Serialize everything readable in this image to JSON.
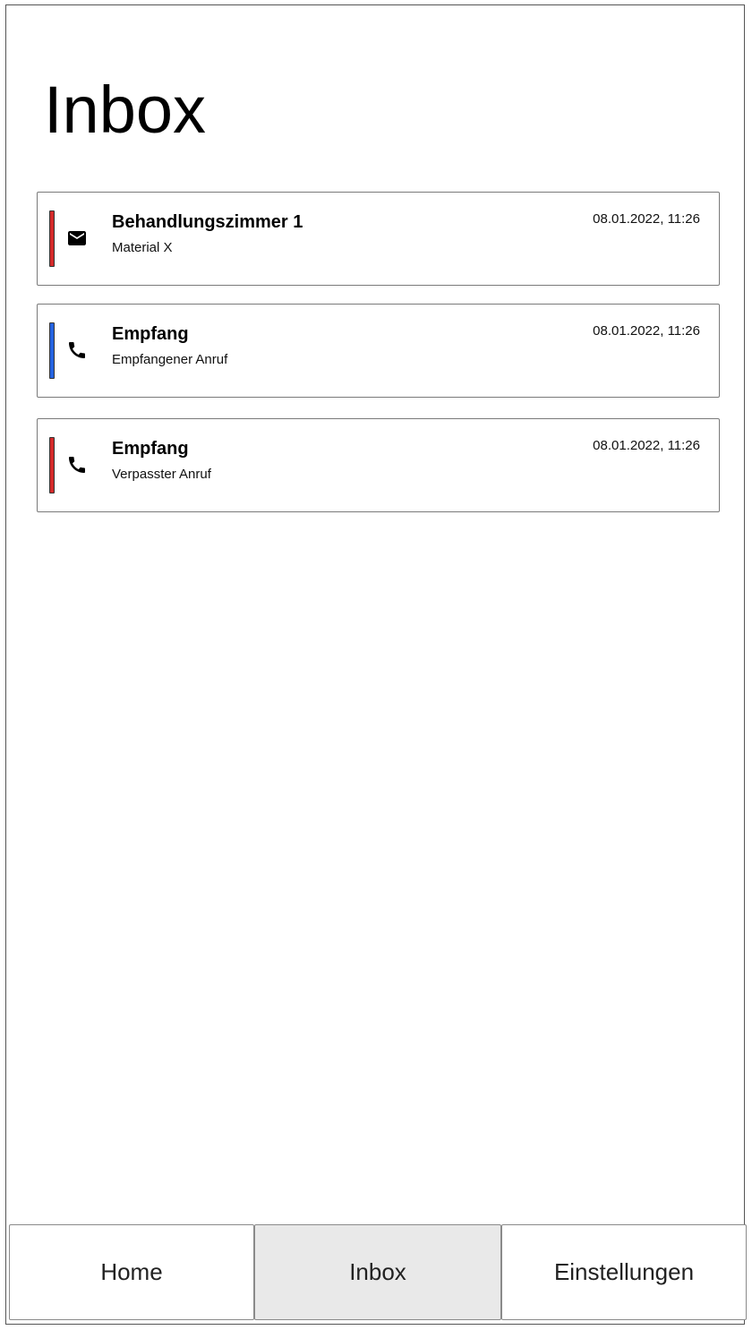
{
  "page": {
    "title": "Inbox"
  },
  "messages": [
    {
      "title": "Behandlungszimmer 1",
      "subtitle": "Material X",
      "timestamp": "08.01.2022, 11:26",
      "icon": "mail-icon",
      "accent": "#d42a2a"
    },
    {
      "title": "Empfang",
      "subtitle": "Empfangener Anruf",
      "timestamp": "08.01.2022, 11:26",
      "icon": "phone-icon",
      "accent": "#2563e0"
    },
    {
      "title": "Empfang",
      "subtitle": "Verpasster Anruf",
      "timestamp": "08.01.2022, 11:26",
      "icon": "phone-icon",
      "accent": "#d42a2a"
    }
  ],
  "tabs": [
    {
      "label": "Home",
      "active": false
    },
    {
      "label": "Inbox",
      "active": true
    },
    {
      "label": "Einstellungen",
      "active": false
    }
  ]
}
